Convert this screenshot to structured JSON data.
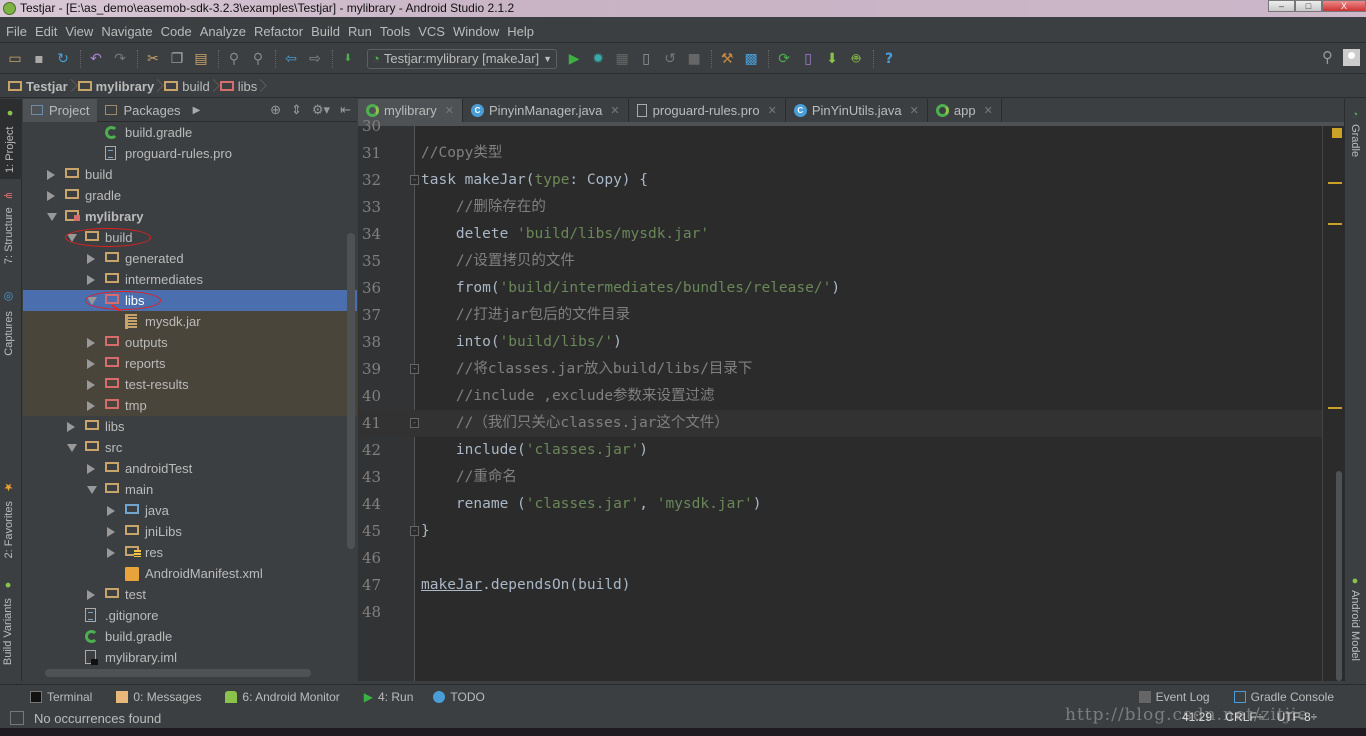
{
  "window": {
    "title": "Testjar - [E:\\as_demo\\easemob-sdk-3.2.3\\examples\\Testjar] - mylibrary - Android Studio 2.1.2",
    "controls": {
      "minimize": "–",
      "maximize": "□",
      "close": "X"
    }
  },
  "menu": [
    "File",
    "Edit",
    "View",
    "Navigate",
    "Code",
    "Analyze",
    "Refactor",
    "Build",
    "Run",
    "Tools",
    "VCS",
    "Window",
    "Help"
  ],
  "toolbar": {
    "run_config": "Testjar:mylibrary [makeJar]"
  },
  "breadcrumb": [
    "Testjar",
    "mylibrary",
    "build",
    "libs"
  ],
  "left_tool_tabs": [
    "1: Project",
    "7: Structure",
    "Captures",
    "2: Favorites",
    "Build Variants"
  ],
  "right_tool_tabs": [
    "Gradle",
    "Android Model"
  ],
  "project_panel": {
    "tabs": [
      "Project",
      "Packages"
    ],
    "tree": [
      {
        "label": "build.gradle",
        "type": "gradle",
        "depth": 3,
        "arrow": ""
      },
      {
        "label": "proguard-rules.pro",
        "type": "file",
        "depth": 3,
        "arrow": ""
      },
      {
        "label": "build",
        "type": "folder",
        "depth": 1,
        "arrow": "right"
      },
      {
        "label": "gradle",
        "type": "folder",
        "depth": 1,
        "arrow": "right"
      },
      {
        "label": "mylibrary",
        "type": "module",
        "depth": 1,
        "arrow": "down",
        "bold": true
      },
      {
        "label": "build",
        "type": "folder",
        "depth": 2,
        "arrow": "down",
        "circled": true
      },
      {
        "label": "generated",
        "type": "folder",
        "depth": 3,
        "arrow": "right"
      },
      {
        "label": "intermediates",
        "type": "folder",
        "depth": 3,
        "arrow": "right"
      },
      {
        "label": "libs",
        "type": "folder-red",
        "depth": 3,
        "arrow": "down",
        "selected": true,
        "circled": true
      },
      {
        "label": "mysdk.jar",
        "type": "jar",
        "depth": 4,
        "arrow": "",
        "generated": true
      },
      {
        "label": "outputs",
        "type": "folder-red",
        "depth": 3,
        "arrow": "right",
        "generated": true
      },
      {
        "label": "reports",
        "type": "folder-red",
        "depth": 3,
        "arrow": "right",
        "generated": true
      },
      {
        "label": "test-results",
        "type": "folder-red",
        "depth": 3,
        "arrow": "right",
        "generated": true
      },
      {
        "label": "tmp",
        "type": "folder-red",
        "depth": 3,
        "arrow": "right",
        "generated": true
      },
      {
        "label": "libs",
        "type": "folder",
        "depth": 2,
        "arrow": "right"
      },
      {
        "label": "src",
        "type": "folder",
        "depth": 2,
        "arrow": "down"
      },
      {
        "label": "androidTest",
        "type": "folder",
        "depth": 3,
        "arrow": "right"
      },
      {
        "label": "main",
        "type": "folder",
        "depth": 3,
        "arrow": "down"
      },
      {
        "label": "java",
        "type": "folder-blue",
        "depth": 4,
        "arrow": "right"
      },
      {
        "label": "jniLibs",
        "type": "folder",
        "depth": 4,
        "arrow": "right"
      },
      {
        "label": "res",
        "type": "folder-res",
        "depth": 4,
        "arrow": "right"
      },
      {
        "label": "AndroidManifest.xml",
        "type": "xml",
        "depth": 4,
        "arrow": ""
      },
      {
        "label": "test",
        "type": "folder",
        "depth": 3,
        "arrow": "right"
      },
      {
        "label": ".gitignore",
        "type": "file",
        "depth": 2,
        "arrow": ""
      },
      {
        "label": "build.gradle",
        "type": "gradle",
        "depth": 2,
        "arrow": ""
      },
      {
        "label": "mylibrary.iml",
        "type": "iml",
        "depth": 2,
        "arrow": ""
      }
    ]
  },
  "editor": {
    "tabs": [
      {
        "label": "mylibrary",
        "icon": "gradle",
        "active": true
      },
      {
        "label": "PinyinManager.java",
        "icon": "class"
      },
      {
        "label": "proguard-rules.pro",
        "icon": "file"
      },
      {
        "label": "PinYinUtils.java",
        "icon": "class"
      },
      {
        "label": "app",
        "icon": "gradle"
      }
    ],
    "current_line": 41,
    "lines": [
      {
        "n": "30",
        "html": ""
      },
      {
        "n": "31",
        "html": "<span class='cm'>//Copy类型</span>"
      },
      {
        "n": "32",
        "html": "task makeJar(<span class='nm'>type</span>: Copy) {",
        "fold": "open"
      },
      {
        "n": "33",
        "html": "    <span class='cm'>//删除存在的</span>"
      },
      {
        "n": "34",
        "html": "    delete <span class='st'>'build/libs/mysdk.jar'</span>"
      },
      {
        "n": "35",
        "html": "    <span class='cm'>//设置拷贝的文件</span>"
      },
      {
        "n": "36",
        "html": "    from(<span class='st'>'build/intermediates/bundles/release/'</span>)"
      },
      {
        "n": "37",
        "html": "    <span class='cm'>//打进jar包后的文件目录</span>"
      },
      {
        "n": "38",
        "html": "    into(<span class='st'>'build/libs/'</span>)"
      },
      {
        "n": "39",
        "html": "    <span class='cm'>//将classes.jar放入build/libs/目录下</span>",
        "fold": "open"
      },
      {
        "n": "40",
        "html": "    <span class='cm'>//include ,exclude参数来设置过滤</span>"
      },
      {
        "n": "41",
        "html": "    <span class='cm'>//（我们只关心classes.jar这个文件）</span>",
        "fold": "close"
      },
      {
        "n": "42",
        "html": "    include(<span class='st'>'classes.jar'</span>)"
      },
      {
        "n": "43",
        "html": "    <span class='cm'>//重命名</span>"
      },
      {
        "n": "44",
        "html": "    rename (<span class='st'>'classes.jar'</span>, <span class='st'>'mysdk.jar'</span>)"
      },
      {
        "n": "45",
        "html": "}",
        "fold": "close"
      },
      {
        "n": "46",
        "html": ""
      },
      {
        "n": "47",
        "html": "<span class='ul'>makeJar</span>.dependsOn(build)"
      },
      {
        "n": "48",
        "html": ""
      }
    ]
  },
  "bottom_tools": {
    "left": [
      {
        "label": "Terminal",
        "icon": "terminal"
      },
      {
        "label": "0: Messages",
        "icon": "messages"
      },
      {
        "label": "6: Android Monitor",
        "icon": "android"
      },
      {
        "label": "4: Run",
        "icon": "run"
      },
      {
        "label": "TODO",
        "icon": "todo"
      }
    ],
    "right": [
      {
        "label": "Event Log",
        "icon": "event-log"
      },
      {
        "label": "Gradle Console",
        "icon": "gradle-console"
      }
    ]
  },
  "status": {
    "message": "No occurrences found",
    "position": "41:29",
    "line_separator": "CRLF÷",
    "encoding": "UTF-8÷",
    "watermark": "http://blog.csdn.net/zitjie"
  },
  "colors": {
    "accent_selection": "#4b6eaf",
    "editor_bg": "#2b2b2b",
    "panel_bg": "#3c3f41",
    "comment": "#808080",
    "string": "#6a8759"
  }
}
